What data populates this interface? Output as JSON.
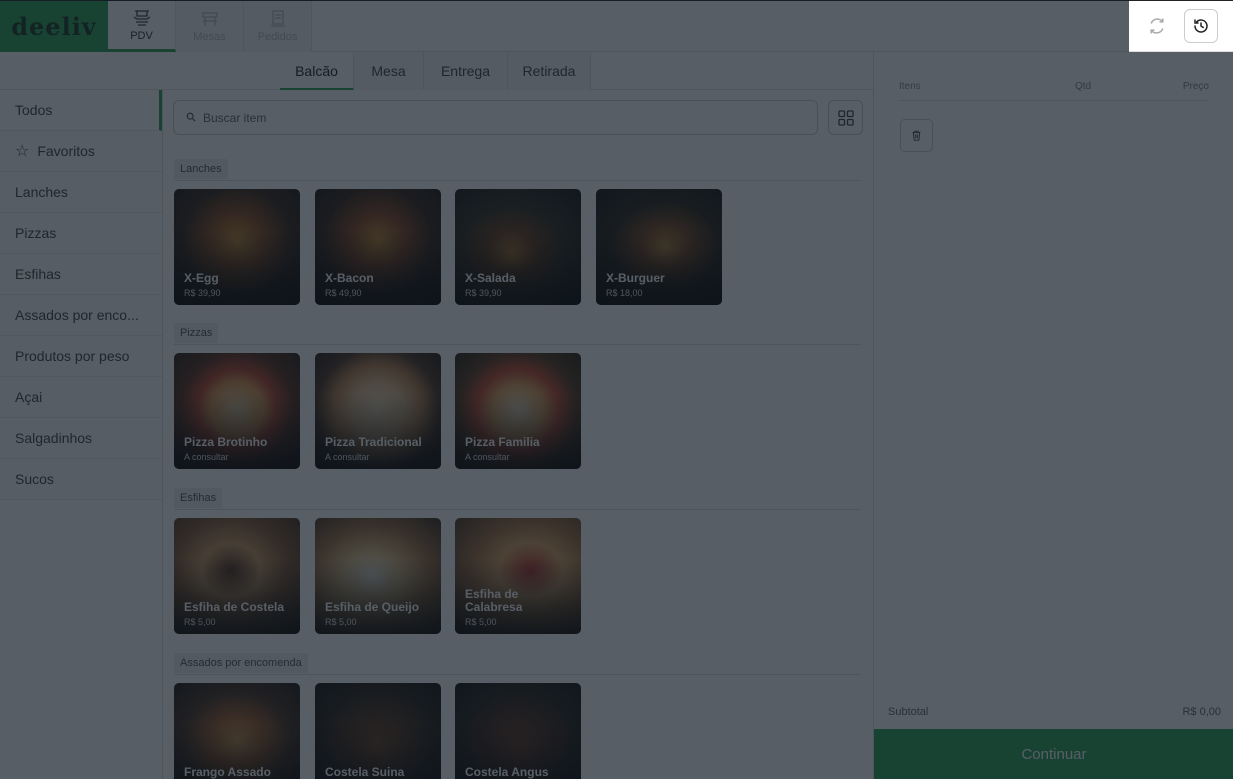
{
  "brand": {
    "logo_text": "deeliv"
  },
  "nav": {
    "pdv": "PDV",
    "mesas": "Mesas",
    "pedidos": "Pedidos"
  },
  "tabs": [
    "Balcão",
    "Mesa",
    "Entrega",
    "Retirada"
  ],
  "categories": [
    "Todos",
    "Favoritos",
    "Lanches",
    "Pizzas",
    "Esfihas",
    "Assados por enco...",
    "Produtos por peso",
    "Açai",
    "Salgadinhos",
    "Sucos"
  ],
  "search": {
    "placeholder": "Buscar item"
  },
  "sections": {
    "lanches": {
      "label": "Lanches",
      "items": [
        {
          "name": "X-Egg",
          "price": "R$ 39,90"
        },
        {
          "name": "X-Bacon",
          "price": "R$ 49,90"
        },
        {
          "name": "X-Salada",
          "price": "R$ 39,90"
        },
        {
          "name": "X-Burguer",
          "price": "R$ 18,00"
        }
      ]
    },
    "pizzas": {
      "label": "Pizzas",
      "items": [
        {
          "name": "Pizza Brotinho",
          "price": "A consultar"
        },
        {
          "name": "Pizza Tradicional",
          "price": "A consultar"
        },
        {
          "name": "Pizza Familia",
          "price": "A consultar"
        }
      ]
    },
    "esfihas": {
      "label": "Esfihas",
      "items": [
        {
          "name": "Esfiha de Costela",
          "price": "R$ 5,00"
        },
        {
          "name": "Esfiha de Queijo",
          "price": "R$ 5,00"
        },
        {
          "name": "Esfiha de Calabresa",
          "price": "R$ 5,00"
        }
      ]
    },
    "assados": {
      "label": "Assados por encomenda",
      "items": [
        {
          "name": "Frango Assado"
        },
        {
          "name": "Costela Suina"
        },
        {
          "name": "Costela Angus"
        }
      ]
    }
  },
  "cart": {
    "col_items": "Itens",
    "col_qty": "Qtd",
    "col_price": "Preço",
    "subtotal_label": "Subtotal",
    "subtotal_value": "R$ 0,00",
    "continue_label": "Continuar"
  },
  "colors": {
    "brand_green": "#2ea658",
    "overlay": "#0f1923"
  },
  "icons": [
    "pdv-icon",
    "mesas-icon",
    "pedidos-icon",
    "sync-icon",
    "history-icon",
    "star-icon",
    "search-icon",
    "grid-icon",
    "trash-icon"
  ]
}
